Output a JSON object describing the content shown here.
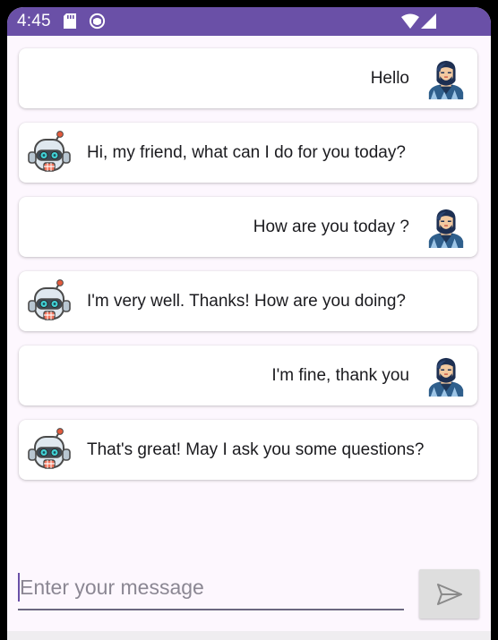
{
  "status_bar": {
    "time": "4:45",
    "background_color": "#6a50a7",
    "icons": [
      "sd-card-icon",
      "circle-app-icon",
      "wifi-icon",
      "signal-icon"
    ]
  },
  "messages": [
    {
      "sender": "user",
      "text": "Hello",
      "avatar_icon": "user-avatar-icon"
    },
    {
      "sender": "bot",
      "text": "Hi, my friend, what can I do for you today?",
      "avatar_icon": "robot-avatar-icon"
    },
    {
      "sender": "user",
      "text": "How are you today ?",
      "avatar_icon": "user-avatar-icon"
    },
    {
      "sender": "bot",
      "text": "I'm very well. Thanks! How are you doing?",
      "avatar_icon": "robot-avatar-icon"
    },
    {
      "sender": "user",
      "text": "I'm fine, thank you",
      "avatar_icon": "user-avatar-icon"
    },
    {
      "sender": "bot",
      "text": "That's great! May I ask you some questions?",
      "avatar_icon": "robot-avatar-icon"
    }
  ],
  "input": {
    "value": "",
    "placeholder": "Enter your message"
  },
  "send_button": {
    "icon": "send-icon"
  },
  "colors": {
    "accent": "#6a50a7",
    "screen_background": "#fdf7fe",
    "card_background": "#ffffff",
    "send_button_background": "#dedede"
  }
}
